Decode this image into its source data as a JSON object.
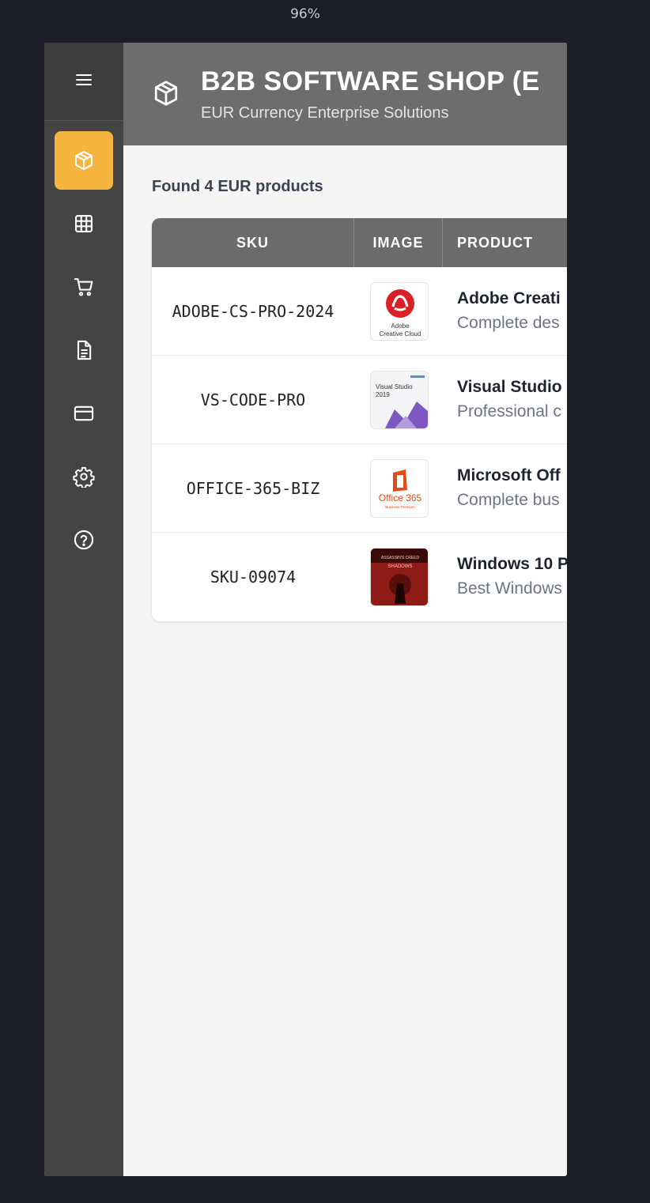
{
  "zoom_level": "96%",
  "sidebar": {
    "menu_icon": "hamburger-icon",
    "items": [
      {
        "name": "products",
        "icon": "box-icon",
        "active": true
      },
      {
        "name": "catalog",
        "icon": "grid-icon",
        "active": false
      },
      {
        "name": "cart",
        "icon": "cart-icon",
        "active": false
      },
      {
        "name": "documents",
        "icon": "document-icon",
        "active": false
      },
      {
        "name": "payments",
        "icon": "credit-card-icon",
        "active": false
      },
      {
        "name": "settings",
        "icon": "gear-icon",
        "active": false
      },
      {
        "name": "help",
        "icon": "help-icon",
        "active": false
      }
    ],
    "active_color": "#f5b53f"
  },
  "header": {
    "title": "B2B SOFTWARE SHOP (E",
    "subtitle": "EUR Currency Enterprise Solutions",
    "icon": "box-icon"
  },
  "results": {
    "summary": "Found 4 EUR products"
  },
  "table": {
    "columns": [
      "SKU",
      "IMAGE",
      "PRODUCT"
    ],
    "rows": [
      {
        "sku": "ADOBE-CS-PRO-2024",
        "image_label_1": "Adobe",
        "image_label_2": "Creative Cloud",
        "name": "Adobe Creati",
        "desc": "Complete des"
      },
      {
        "sku": "VS-CODE-PRO",
        "image_label_1": "Visual Studio",
        "image_label_2": "2019",
        "name": "Visual Studio",
        "desc": "Professional c"
      },
      {
        "sku": "OFFICE-365-BIZ",
        "image_label_1": "Office 365",
        "image_label_2": "Business Premium",
        "name": "Microsoft Off",
        "desc": "Complete bus"
      },
      {
        "sku": "SKU-09074",
        "image_label_1": "ASSASSIN'S CREED",
        "image_label_2": "SHADOWS",
        "name": "Windows 10 P",
        "desc": "Best Windows"
      }
    ]
  }
}
